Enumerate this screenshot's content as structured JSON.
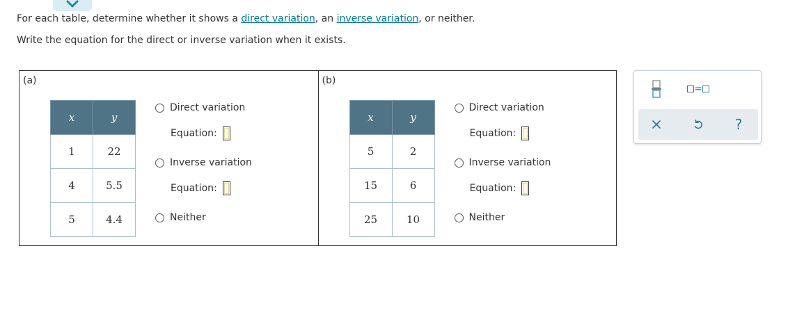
{
  "instructions": {
    "line1_before": "For each table, determine whether it shows a ",
    "direct_link": "direct variation",
    "line1_middle": ", an ",
    "inverse_link": "inverse variation",
    "line1_after": ", or neither.",
    "line2": "Write the equation for the direct or inverse variation when it exists."
  },
  "panels": [
    {
      "label": "(a)",
      "headers": [
        "x",
        "y"
      ],
      "rows": [
        [
          "1",
          "22"
        ],
        [
          "4",
          "5.5"
        ],
        [
          "5",
          "4.4"
        ]
      ],
      "options": {
        "direct": "Direct variation",
        "inverse": "Inverse variation",
        "neither": "Neither"
      },
      "equation_label": "Equation:"
    },
    {
      "label": "(b)",
      "headers": [
        "x",
        "y"
      ],
      "rows": [
        [
          "5",
          "2"
        ],
        [
          "15",
          "6"
        ],
        [
          "25",
          "10"
        ]
      ],
      "options": {
        "direct": "Direct variation",
        "inverse": "Inverse variation",
        "neither": "Neither"
      },
      "equation_label": "Equation:"
    }
  ],
  "toolbar": {
    "icons": [
      "fraction-icon",
      "equation-icon",
      "close-icon",
      "undo-icon",
      "help-icon"
    ],
    "help_glyph": "?",
    "equals_glyph": "=",
    "accent_color": "#1a8aa3"
  },
  "colors": {
    "table_header": "#4e7485",
    "link": "#007a94"
  }
}
